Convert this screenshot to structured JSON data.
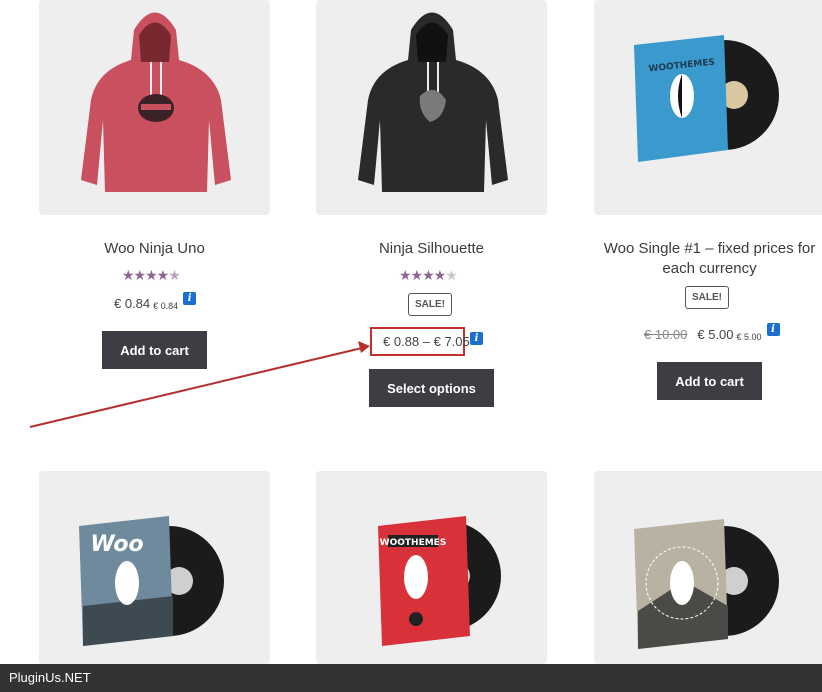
{
  "products_row1": [
    {
      "title_lines": [
        "Woo Ninja Uno"
      ],
      "rating": 4.5,
      "stars": "★★★★",
      "half": "★",
      "empty": "",
      "sale": "",
      "price_old": "",
      "price": "€ 0.84",
      "price_small": "€ 0.84",
      "button": "Add to cart"
    },
    {
      "title_lines": [
        "Ninja Silhouette"
      ],
      "rating": 4,
      "stars": "★★★★",
      "half": "",
      "empty": "★",
      "sale": "SALE!",
      "price_old": "",
      "price": "€ 0.88 – € 7.05",
      "price_small": "",
      "button": "Select options"
    },
    {
      "title_lines": [
        "Woo Single #1 – fixed prices for",
        "each currency"
      ],
      "rating": 0,
      "stars": "",
      "half": "",
      "empty": "",
      "sale": "SALE!",
      "price_old": "€ 10.00",
      "price": "€ 5.00",
      "price_small": "€ 5.00",
      "button": "Add to cart"
    }
  ],
  "info_icon": "i",
  "icons": {
    "info": "info-icon",
    "rating": "star-icon"
  },
  "colors": {
    "button": "#3d3d43",
    "star": "#8d6590",
    "highlight": "#c6302c",
    "info": "#1a6fd1",
    "footer": "#333333"
  },
  "footer": {
    "brand": "PluginUs.NET"
  }
}
